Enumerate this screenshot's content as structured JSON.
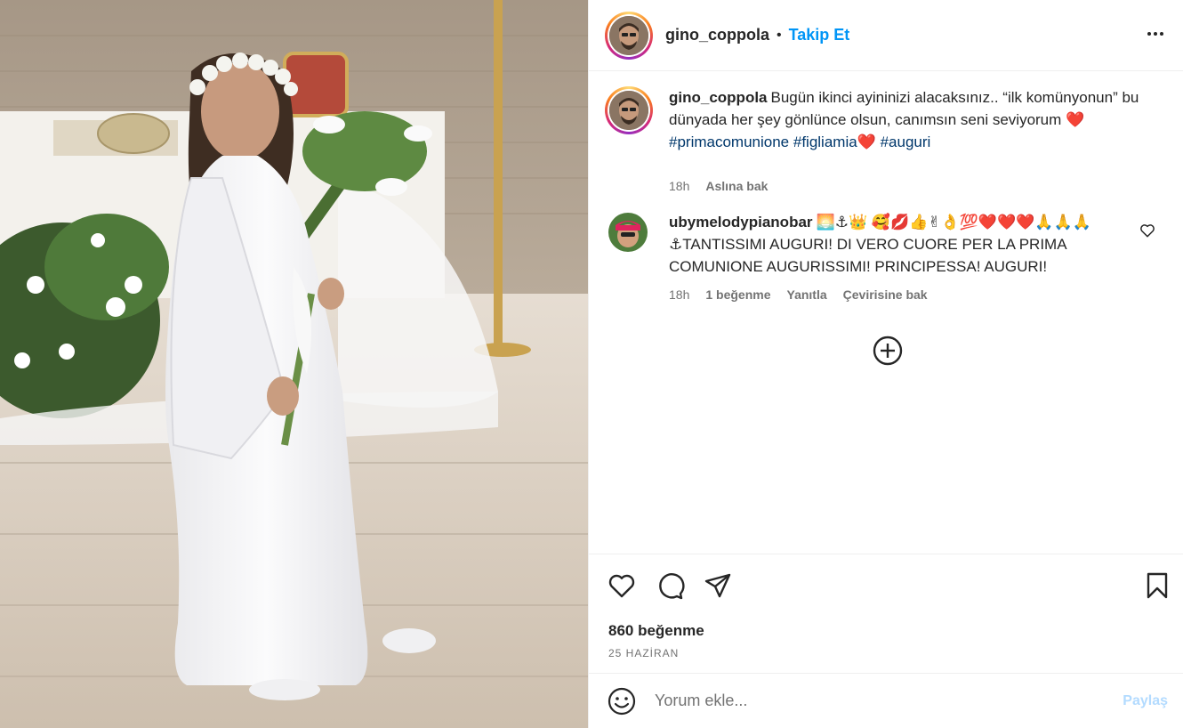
{
  "post": {
    "username": "gino_coppola",
    "follow_label": "Takip Et",
    "separator": "•"
  },
  "caption": {
    "username": "gino_coppola",
    "text_part1": "Bugün ikinci ayininizi alacaksınız.. “ilk komünyonun” bu dünyada her şey gönlünce olsun, canımsın seni seviyorum ",
    "emoji1": "❤️",
    "hashtag1": "#primacomunione",
    "hashtag2": "#figliamia",
    "emoji2": "❤️",
    "hashtag3": "#auguri",
    "time": "18h",
    "see_translation": "Aslına bak"
  },
  "comment1": {
    "username": "ubymelodypianobar",
    "text": "🌅⚓👑 🥰💋👍✌👌💯❤️❤️❤️🙏🙏🙏⚓TANTISSIMI AUGURI! DI VERO CUORE PER LA PRIMA COMUNIONE AUGURISSIMI! PRINCIPESSA! AUGURI!",
    "time": "18h",
    "likes": "1 beğenme",
    "reply": "Yanıtla",
    "see_translation": "Çevirisine bak"
  },
  "footer": {
    "likes_count": "860 beğenme",
    "date": "25 HAZİRAN",
    "comment_placeholder": "Yorum ekle...",
    "post_label": "Paylaş"
  },
  "colors": {
    "accent": "#0095f6",
    "hashtag": "#00376b",
    "muted": "#737373",
    "post_disabled": "#b3dbff"
  }
}
